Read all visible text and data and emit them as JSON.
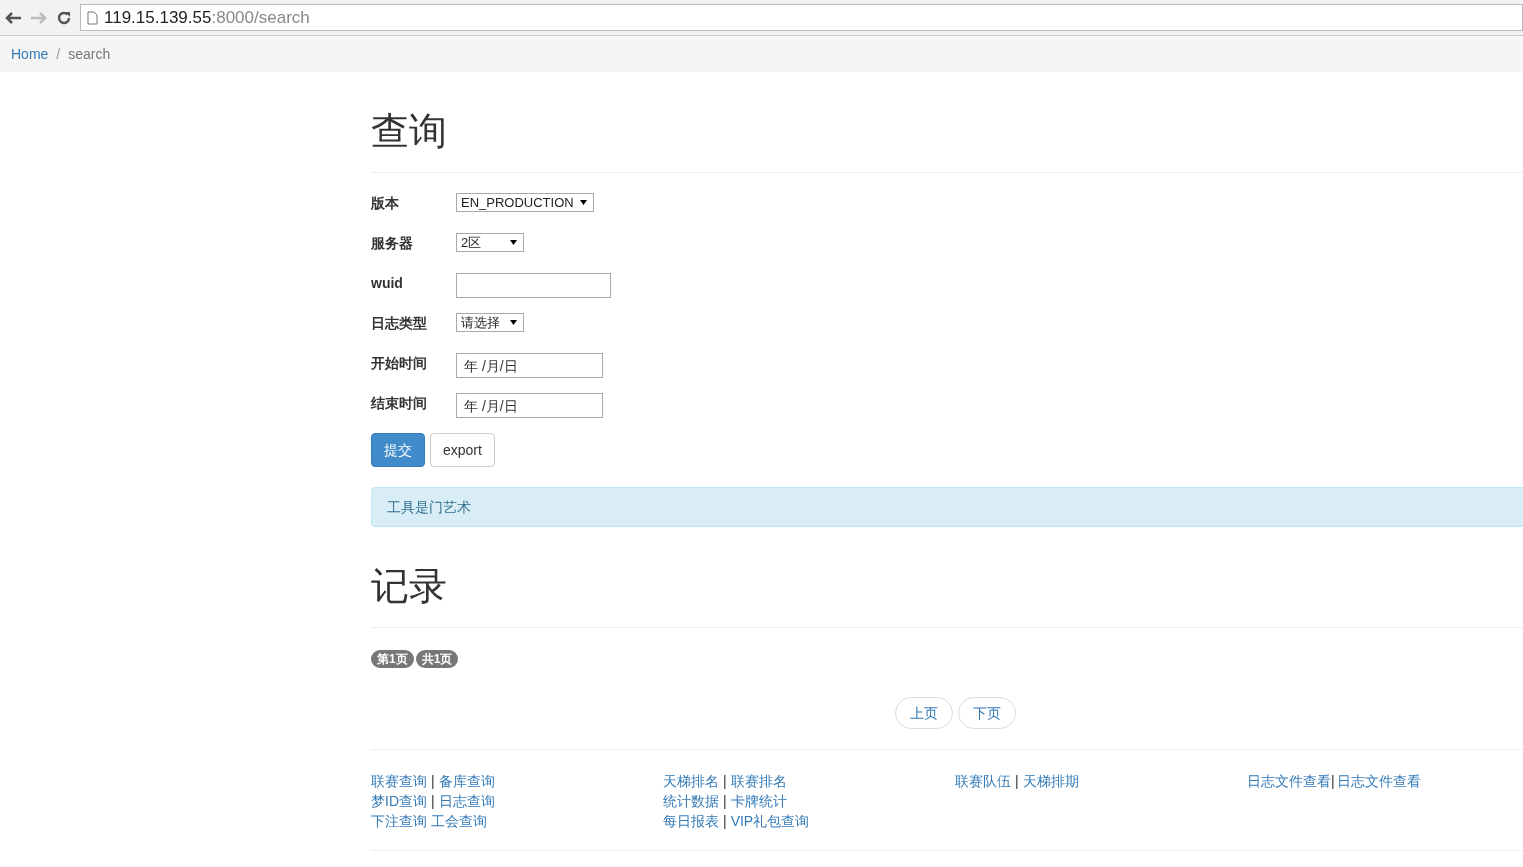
{
  "browser": {
    "url_host": "119.15.139.55",
    "url_rest": ":8000/search"
  },
  "breadcrumb_separator": "/",
  "breadcrumb": [
    {
      "text": "Home",
      "kind": "link"
    },
    {
      "text": "search",
      "kind": "current"
    }
  ],
  "query": {
    "title": "查询",
    "fields": [
      {
        "label": "版本",
        "kind": "select",
        "value": "EN_PRODUCTION"
      },
      {
        "label": "服务器",
        "kind": "select",
        "value": "2区"
      },
      {
        "label": "wuid",
        "kind": "text"
      },
      {
        "label": "日志类型",
        "kind": "select",
        "value": "请选择"
      },
      {
        "label": "开始时间",
        "kind": "date",
        "placeholder": "年 /月/日"
      },
      {
        "label": "结束时间",
        "kind": "date",
        "placeholder": "年 /月/日"
      }
    ],
    "buttons": [
      {
        "label": "提交",
        "primary": true
      },
      {
        "label": "export",
        "primary": false
      }
    ],
    "alert": "工具是门艺术"
  },
  "records": {
    "title": "记录",
    "badges": [
      "第1页",
      "共1页"
    ],
    "pager": [
      "上页",
      "下页"
    ]
  },
  "footer": [
    {
      "lines": [
        [
          {
            "kind": "link",
            "text": "联赛查询"
          },
          {
            "kind": "sep",
            "text": "|"
          },
          {
            "kind": "link",
            "text": "备库查询"
          }
        ],
        [
          {
            "kind": "link",
            "text": "梦ID查询"
          },
          {
            "kind": "sep",
            "text": "|"
          },
          {
            "kind": "link",
            "text": "日志查询"
          }
        ],
        [
          {
            "kind": "link",
            "text": "下注查询"
          },
          {
            "kind": "link",
            "text": "工会查询"
          }
        ]
      ]
    },
    {
      "lines": [
        [
          {
            "kind": "link",
            "text": "天梯排名"
          },
          {
            "kind": "sep",
            "text": "|"
          },
          {
            "kind": "link",
            "text": "联赛排名"
          }
        ],
        [
          {
            "kind": "link",
            "text": "统计数据"
          },
          {
            "kind": "sep",
            "text": "|"
          },
          {
            "kind": "link",
            "text": "卡牌统计"
          }
        ],
        [
          {
            "kind": "link",
            "text": "每日报表"
          },
          {
            "kind": "sep",
            "text": "|"
          },
          {
            "kind": "link",
            "text": "VIP礼包查询"
          }
        ]
      ]
    },
    {
      "lines": [
        [
          {
            "kind": "link",
            "text": "联赛队伍"
          },
          {
            "kind": "sep",
            "text": "|"
          },
          {
            "kind": "link",
            "text": "天梯排期"
          }
        ]
      ]
    },
    {
      "lines": [
        [
          {
            "kind": "link",
            "text": "日志文件查看"
          },
          {
            "kind": "tightsep",
            "text": "|"
          },
          {
            "kind": "link",
            "text": "日志文件查看"
          }
        ]
      ]
    }
  ]
}
